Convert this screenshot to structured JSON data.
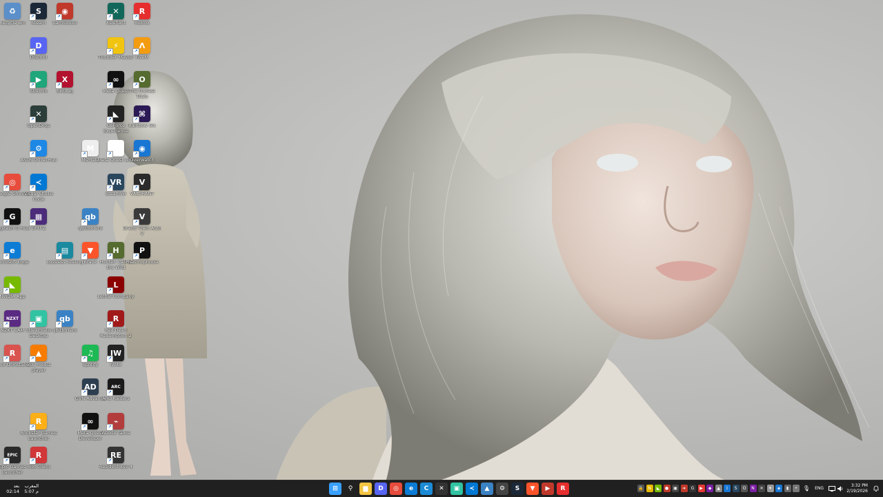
{
  "desktop": {
    "icons": [
      {
        "label": "Recycle Bin",
        "glyph": "♻",
        "color": "#5b8fc9"
      },
      {
        "label": "Steam",
        "glyph": "S",
        "color": "#1b2838"
      },
      {
        "label": "CamStudio",
        "glyph": "◉",
        "color": "#c0392b"
      },
      {
        "label": "Discord",
        "glyph": "D",
        "color": "#5865f2"
      },
      {
        "label": "Stremio",
        "glyph": "▶",
        "color": "#1fa67a"
      },
      {
        "label": "ExitLag",
        "glyph": "X",
        "color": "#b3122e"
      },
      {
        "label": "OpenDrop",
        "glyph": "✕",
        "color": "#2c3e3a"
      },
      {
        "label": "ASUS DriverHub",
        "glyph": "⚙",
        "color": "#1e88e5"
      },
      {
        "label": "Msmate",
        "glyph": "M",
        "color": "#eeeeee"
      },
      {
        "label": "Google Chrome",
        "glyph": "◎",
        "color": "#e74c3c"
      },
      {
        "label": "Visual Studio Code",
        "glyph": "≺",
        "color": "#0078d4"
      },
      {
        "label": "Logitech G HUB",
        "glyph": "G",
        "color": "#111111"
      },
      {
        "label": "GPU-Z",
        "glyph": "▦",
        "color": "#4b2b7a"
      },
      {
        "label": "qBittorrent",
        "glyph": "qb",
        "color": "#3b82c4"
      },
      {
        "label": "Microsoft Edge",
        "glyph": "e",
        "color": "#0c7cd5"
      },
      {
        "label": "Lossless Scaling",
        "glyph": "▤",
        "color": "#1a8aa0"
      },
      {
        "label": "Brave",
        "glyph": "▼",
        "color": "#fb542b"
      },
      {
        "label": "NVIDIA App",
        "glyph": "◣",
        "color": "#76b900"
      },
      {
        "label": "NZXT CAM",
        "glyph": "NZXT",
        "color": "#5a2a82"
      },
      {
        "label": "Streamlabs Desktop",
        "glyph": "▣",
        "color": "#31c3a2"
      },
      {
        "label": "qBittorrent",
        "glyph": "qb",
        "color": "#3b82c4"
      },
      {
        "label": "Revo Uninstaller",
        "glyph": "R",
        "color": "#d9534f"
      },
      {
        "label": "VLC media player",
        "glyph": "▲",
        "color": "#f57c00"
      },
      {
        "label": "Spotify",
        "glyph": "♫",
        "color": "#1db954"
      },
      {
        "label": "GVN Advance",
        "glyph": "AD",
        "color": "#2c3e50"
      },
      {
        "label": "Rockstar Games Launcher",
        "glyph": "R",
        "color": "#fcaf17"
      },
      {
        "label": "Meta Quest Developer",
        "glyph": "∞",
        "color": "#111111"
      },
      {
        "label": "Epic Games Launcher",
        "glyph": "EPIC",
        "color": "#2a2a2a"
      },
      {
        "label": "Riot Client",
        "glyph": "R",
        "color": "#d13639"
      },
      {
        "label": "XDefiant",
        "glyph": "✕",
        "color": "#11685a"
      },
      {
        "label": "Thunder Master",
        "glyph": "⚡",
        "color": "#f1c40f"
      },
      {
        "label": "Meta Quest",
        "glyph": "∞",
        "color": "#111111"
      },
      {
        "label": "GeForce Experience",
        "glyph": "◣",
        "color": "#222222"
      },
      {
        "label": "Meta Quest Link",
        "glyph": "∞",
        "color": "#ffffff"
      },
      {
        "label": "SteamVR",
        "glyph": "VR",
        "color": "#2a475e"
      },
      {
        "label": "Grand Theft Auto V",
        "glyph": "V",
        "color": "#3a3a3a"
      },
      {
        "label": "Hunter: Call of the Wild",
        "glyph": "H",
        "color": "#556b2f"
      },
      {
        "label": "Lethal Company",
        "glyph": "L",
        "color": "#8b0000"
      },
      {
        "label": "Red Dead Redemption 2",
        "glyph": "R",
        "color": "#a11a1a"
      },
      {
        "label": "IW4x",
        "glyph": "IW",
        "color": "#222222"
      },
      {
        "label": "ARC Raiders",
        "glyph": "ARC",
        "color": "#1a1a1a"
      },
      {
        "label": "Walkie Talkie",
        "glyph": "⌁",
        "color": "#b33c3c"
      },
      {
        "label": "Resident Evil 4",
        "glyph": "RE",
        "color": "#333333"
      },
      {
        "label": "Roblox",
        "glyph": "R",
        "color": "#e62e2e"
      },
      {
        "label": "FiveM",
        "glyph": "Λ",
        "color": "#f39c12"
      },
      {
        "label": "The Outlast Trials",
        "glyph": "O",
        "color": "#556b2f"
      },
      {
        "label": "Rainbow Six",
        "glyph": "⌘",
        "color": "#2b1a55"
      },
      {
        "label": "Overwatch",
        "glyph": "◉",
        "color": "#1976d2"
      },
      {
        "label": "VALORANT",
        "glyph": "V",
        "color": "#2b2b2b"
      },
      {
        "label": "Phasmophobia",
        "glyph": "P",
        "color": "#111111"
      }
    ]
  },
  "taskbar": {
    "left_clock_day": "بعد",
    "left_clock_time": "02:14",
    "left_prayer_name": "المغرب",
    "left_prayer_time": "5:07 م",
    "pinned": [
      {
        "name": "start",
        "glyph": "⊞",
        "color": "#3aa0ff"
      },
      {
        "name": "search",
        "glyph": "⚲",
        "color": "#202020"
      },
      {
        "name": "file-explorer",
        "glyph": "▆",
        "color": "#f4c542"
      },
      {
        "name": "discord",
        "glyph": "D",
        "color": "#5865f2"
      },
      {
        "name": "chrome",
        "glyph": "◎",
        "color": "#e74c3c"
      },
      {
        "name": "edge",
        "glyph": "e",
        "color": "#0c7cd5"
      },
      {
        "name": "cleanmaster",
        "glyph": "C",
        "color": "#1c8bd6"
      },
      {
        "name": "xbox-app",
        "glyph": "✕",
        "color": "#333333"
      },
      {
        "name": "streamlabs",
        "glyph": "▣",
        "color": "#31c3a2"
      },
      {
        "name": "vscode",
        "glyph": "≺",
        "color": "#0078d4"
      },
      {
        "name": "photos",
        "glyph": "▲",
        "color": "#3b82c4"
      },
      {
        "name": "settings",
        "glyph": "⚙",
        "color": "#444444"
      },
      {
        "name": "steam",
        "glyph": "S",
        "color": "#1b2838"
      },
      {
        "name": "brave",
        "glyph": "▼",
        "color": "#fb542b"
      },
      {
        "name": "media",
        "glyph": "▶",
        "color": "#c0392b"
      },
      {
        "name": "roblox",
        "glyph": "R",
        "color": "#e62e2e"
      }
    ],
    "tray": [
      {
        "name": "lock",
        "glyph": "🔒",
        "color": "#555555"
      },
      {
        "name": "norton",
        "glyph": "N",
        "color": "#e6b800"
      },
      {
        "name": "nvidia",
        "glyph": "◣",
        "color": "#76b900"
      },
      {
        "name": "record",
        "glyph": "●",
        "color": "#c0392b"
      },
      {
        "name": "cpu",
        "glyph": "▣",
        "color": "#444444"
      },
      {
        "name": "arrow",
        "glyph": "➜",
        "color": "#c0392b"
      },
      {
        "name": "logitech",
        "glyph": "G",
        "color": "#333333"
      },
      {
        "name": "youtube",
        "glyph": "▶",
        "color": "#e53935"
      },
      {
        "name": "app-1",
        "glyph": "◆",
        "color": "#7b1fa2"
      },
      {
        "name": "app-2",
        "glyph": "▲",
        "color": "#888888"
      },
      {
        "name": "bluetooth",
        "glyph": "ᛒ",
        "color": "#1976d2"
      },
      {
        "name": "steam-tray",
        "glyph": "S",
        "color": "#2a475e"
      },
      {
        "name": "overwolf",
        "glyph": "O",
        "color": "#555555"
      },
      {
        "name": "onenote",
        "glyph": "N",
        "color": "#7b1fa2"
      },
      {
        "name": "xbox-tray",
        "glyph": "✕",
        "color": "#444444"
      },
      {
        "name": "app-3",
        "glyph": "✦",
        "color": "#999999"
      },
      {
        "name": "dropbox",
        "glyph": "◈",
        "color": "#1976d2"
      },
      {
        "name": "app-4",
        "glyph": "▮",
        "color": "#666666"
      },
      {
        "name": "app-5",
        "glyph": "•",
        "color": "#777777"
      }
    ],
    "mic_glyph": "🎙",
    "language": "ENG",
    "clock_time": "3:32 PM",
    "clock_date": "2/19/2026"
  }
}
